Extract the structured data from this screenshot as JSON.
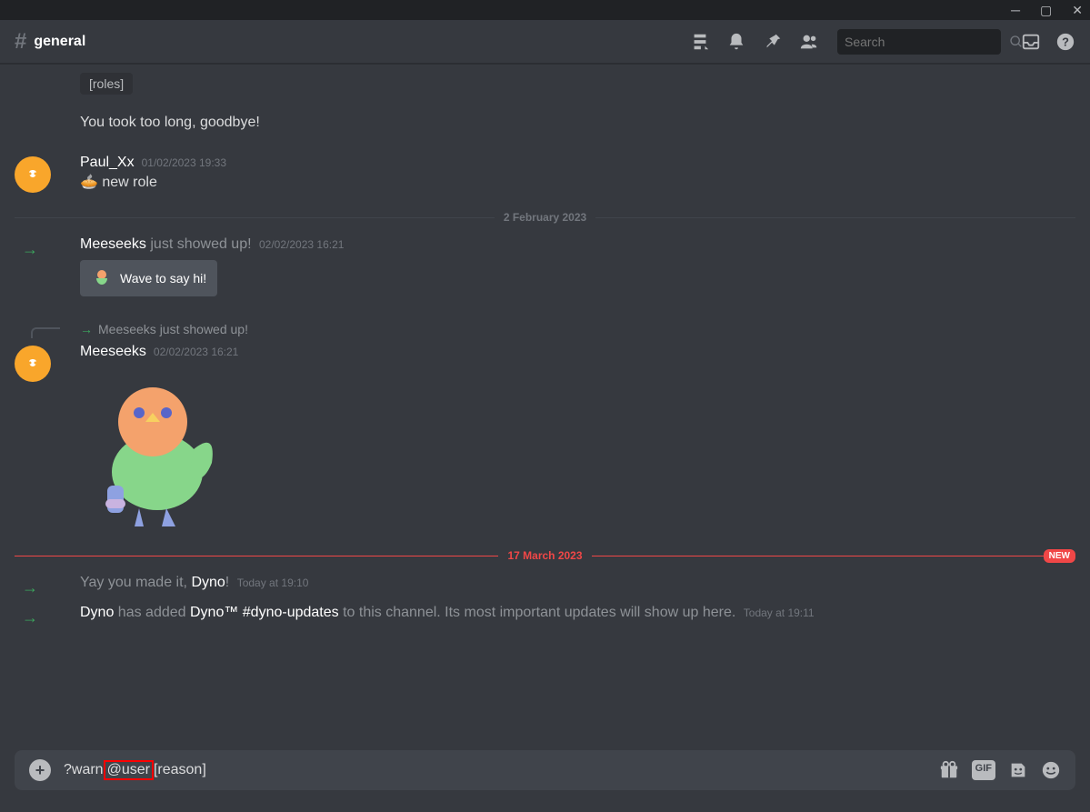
{
  "header": {
    "channel_name": "general"
  },
  "search": {
    "placeholder": "Search"
  },
  "roles_chip": "[roles]",
  "goodbye_text": "You took too long, goodbye!",
  "m1": {
    "name": "Paul_Xx",
    "ts": "01/02/2023 19:33",
    "text": "new role"
  },
  "div1": "2 February 2023",
  "join1": {
    "name": "Meeseeks",
    "suffix": " just showed up!",
    "ts": "02/02/2023 16:21",
    "wave": "Wave to say hi!"
  },
  "reply": {
    "text": "Meeseeks just showed up!"
  },
  "m2": {
    "name": "Meeseeks",
    "ts": "02/02/2023 16:21"
  },
  "div2": {
    "text": "17 March 2023",
    "pill": "NEW"
  },
  "join2": {
    "pre": "Yay you made it, ",
    "name": "Dyno",
    "post": "!",
    "ts": "Today at 19:10"
  },
  "join3": {
    "name": "Dyno",
    "mid1": " has added ",
    "channel": "Dyno™ #dyno-updates",
    "mid2": " to this channel. Its most important updates will show up here.",
    "ts": "Today at 19:11"
  },
  "input": {
    "pre": "?warn ",
    "highlight": "@user",
    "post": " [reason]"
  },
  "icons": {
    "gif": "GIF"
  }
}
